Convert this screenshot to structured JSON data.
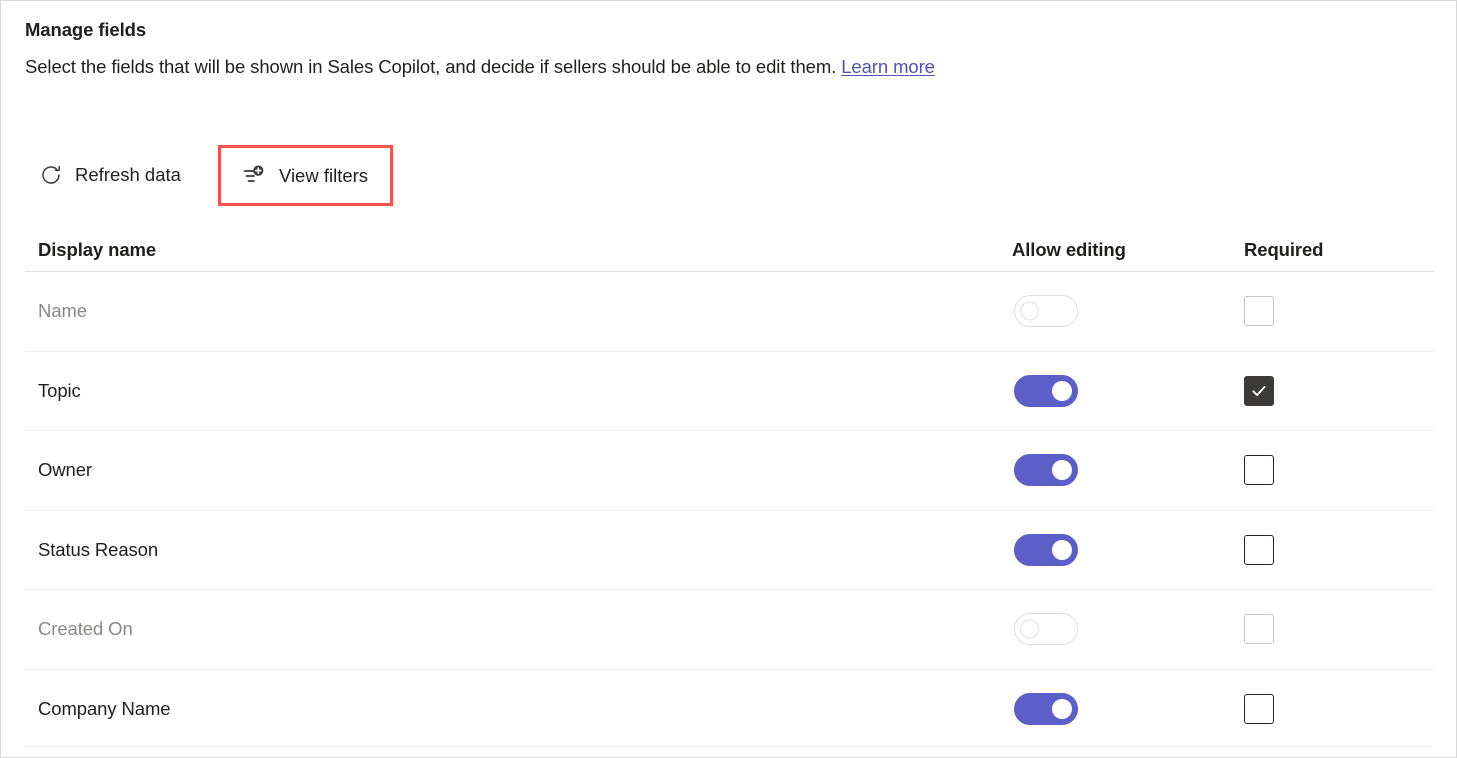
{
  "header": {
    "title": "Manage fields",
    "subtitle_prefix": "Select the fields that will be shown in Sales Copilot, and decide if sellers should be able to edit them. ",
    "link_label": "Learn more"
  },
  "command_bar": {
    "refresh": {
      "label": "Refresh data",
      "icon": "refresh-icon"
    },
    "view_filters": {
      "label": "View filters",
      "icon": "filter-add-icon",
      "highlighted": true
    }
  },
  "annotation": {
    "highlight_color": "#f0544c"
  },
  "table": {
    "columns": [
      {
        "key": "display_name",
        "label": "Display name"
      },
      {
        "key": "allow_editing",
        "label": "Allow editing"
      },
      {
        "key": "required",
        "label": "Required"
      }
    ],
    "rows": [
      {
        "display_name": "Name",
        "allow_editing": "off",
        "required": "unchecked",
        "disabled": true
      },
      {
        "display_name": "Topic",
        "allow_editing": "on",
        "required": "checked",
        "disabled": false
      },
      {
        "display_name": "Owner",
        "allow_editing": "on",
        "required": "unchecked",
        "disabled": false
      },
      {
        "display_name": "Status Reason",
        "allow_editing": "on",
        "required": "unchecked",
        "disabled": false
      },
      {
        "display_name": "Created On",
        "allow_editing": "off",
        "required": "unchecked",
        "disabled": true
      },
      {
        "display_name": "Company Name",
        "allow_editing": "on",
        "required": "unchecked",
        "disabled": false
      }
    ]
  },
  "colors": {
    "toggle_on": "#5b5fc7",
    "checkbox_checked": "#3b3a39",
    "link": "#4f52b2",
    "highlight_box": "#f0544c"
  }
}
